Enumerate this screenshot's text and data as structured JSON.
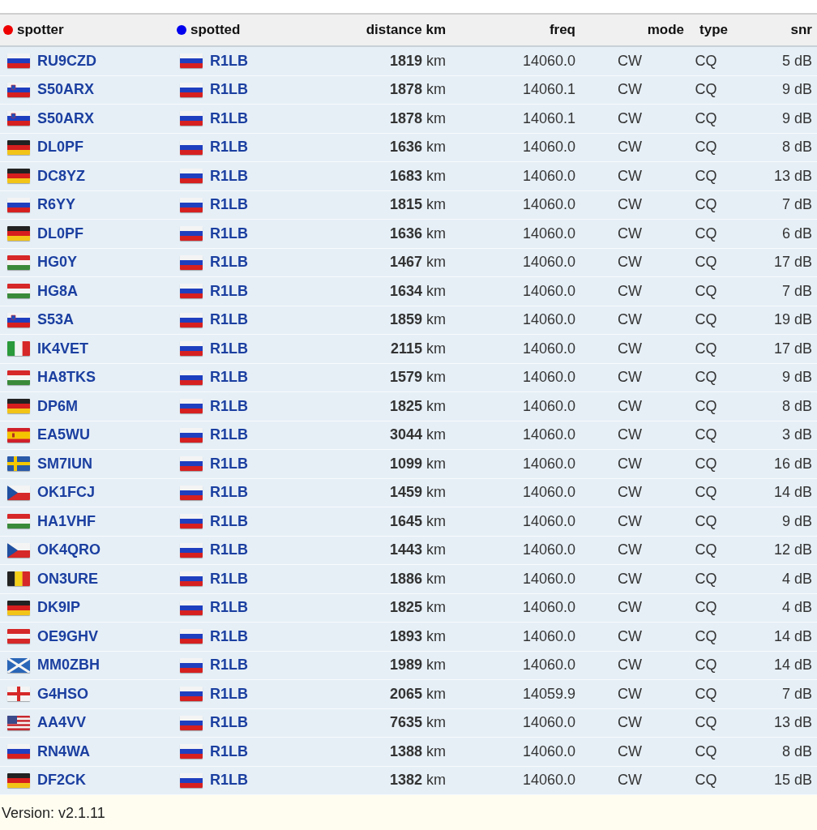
{
  "columns": [
    {
      "label": "spotter",
      "color": "#ee0000"
    },
    {
      "label": "spotted",
      "color": "#0000ee"
    },
    {
      "label": "distance km"
    },
    {
      "label": "freq"
    },
    {
      "label": "mode"
    },
    {
      "label": "type"
    },
    {
      "label": "snr"
    }
  ],
  "rows": [
    {
      "spotter": {
        "kind": "ru",
        "call": "RU9CZD"
      },
      "spotted": {
        "kind": "ru",
        "call": "R1LB"
      },
      "distance": "**1819** km",
      "freq": "14060.0",
      "mode": "CW",
      "type": "CQ",
      "snr": "5 dB"
    },
    {
      "spotter": {
        "kind": "si",
        "call": "S50ARX"
      },
      "spotted": {
        "kind": "ru",
        "call": "R1LB"
      },
      "distance": "**1878** km",
      "freq": "14060.1",
      "mode": "CW",
      "type": "CQ",
      "snr": "9 dB"
    },
    {
      "spotter": {
        "kind": "si",
        "call": "S50ARX"
      },
      "spotted": {
        "kind": "ru",
        "call": "R1LB"
      },
      "distance": "**1878** km",
      "freq": "14060.1",
      "mode": "CW",
      "type": "CQ",
      "snr": "9 dB"
    },
    {
      "spotter": {
        "kind": "de",
        "call": "DL0PF"
      },
      "spotted": {
        "kind": "ru",
        "call": "R1LB"
      },
      "distance": "**1636** km",
      "freq": "14060.0",
      "mode": "CW",
      "type": "CQ",
      "snr": "8 dB"
    },
    {
      "spotter": {
        "kind": "de",
        "call": "DC8YZ"
      },
      "spotted": {
        "kind": "ru",
        "call": "R1LB"
      },
      "distance": "**1683** km",
      "freq": "14060.0",
      "mode": "CW",
      "type": "CQ",
      "snr": "13 dB"
    },
    {
      "spotter": {
        "kind": "ru",
        "call": "R6YY"
      },
      "spotted": {
        "kind": "ru",
        "call": "R1LB"
      },
      "distance": "**1815** km",
      "freq": "14060.0",
      "mode": "CW",
      "type": "CQ",
      "snr": "7 dB"
    },
    {
      "spotter": {
        "kind": "de",
        "call": "DL0PF"
      },
      "spotted": {
        "kind": "ru",
        "call": "R1LB"
      },
      "distance": "**1636** km",
      "freq": "14060.0",
      "mode": "CW",
      "type": "CQ",
      "snr": "6 dB"
    },
    {
      "spotter": {
        "kind": "hu",
        "call": "HG0Y"
      },
      "spotted": {
        "kind": "ru",
        "call": "R1LB"
      },
      "distance": "**1467** km",
      "freq": "14060.0",
      "mode": "CW",
      "type": "CQ",
      "snr": "17 dB"
    },
    {
      "spotter": {
        "kind": "hu",
        "call": "HG8A"
      },
      "spotted": {
        "kind": "ru",
        "call": "R1LB"
      },
      "distance": "**1634** km",
      "freq": "14060.0",
      "mode": "CW",
      "type": "CQ",
      "snr": "7 dB"
    },
    {
      "spotter": {
        "kind": "si",
        "call": "S53A"
      },
      "spotted": {
        "kind": "ru",
        "call": "R1LB"
      },
      "distance": "**1859** km",
      "freq": "14060.0",
      "mode": "CW",
      "type": "CQ",
      "snr": "19 dB"
    },
    {
      "spotter": {
        "kind": "it",
        "call": "IK4VET"
      },
      "spotted": {
        "kind": "ru",
        "call": "R1LB"
      },
      "distance": "**2115** km",
      "freq": "14060.0",
      "mode": "CW",
      "type": "CQ",
      "snr": "17 dB"
    },
    {
      "spotter": {
        "kind": "hu",
        "call": "HA8TKS"
      },
      "spotted": {
        "kind": "ru",
        "call": "R1LB"
      },
      "distance": "**1579** km",
      "freq": "14060.0",
      "mode": "CW",
      "type": "CQ",
      "snr": "9 dB"
    },
    {
      "spotter": {
        "kind": "de",
        "call": "DP6M"
      },
      "spotted": {
        "kind": "ru",
        "call": "R1LB"
      },
      "distance": "**1825** km",
      "freq": "14060.0",
      "mode": "CW",
      "type": "CQ",
      "snr": "8 dB"
    },
    {
      "spotter": {
        "kind": "es",
        "call": "EA5WU"
      },
      "spotted": {
        "kind": "ru",
        "call": "R1LB"
      },
      "distance": "**3044** km",
      "freq": "14060.0",
      "mode": "CW",
      "type": "CQ",
      "snr": "3 dB"
    },
    {
      "spotter": {
        "kind": "se",
        "call": "SM7IUN"
      },
      "spotted": {
        "kind": "ru",
        "call": "R1LB"
      },
      "distance": "**1099** km",
      "freq": "14060.0",
      "mode": "CW",
      "type": "CQ",
      "snr": "16 dB"
    },
    {
      "spotter": {
        "kind": "cz",
        "call": "OK1FCJ"
      },
      "spotted": {
        "kind": "ru",
        "call": "R1LB"
      },
      "distance": "**1459** km",
      "freq": "14060.0",
      "mode": "CW",
      "type": "CQ",
      "snr": "14 dB"
    },
    {
      "spotter": {
        "kind": "hu",
        "call": "HA1VHF"
      },
      "spotted": {
        "kind": "ru",
        "call": "R1LB"
      },
      "distance": "**1645** km",
      "freq": "14060.0",
      "mode": "CW",
      "type": "CQ",
      "snr": "9 dB"
    },
    {
      "spotter": {
        "kind": "cz",
        "call": "OK4QRO"
      },
      "spotted": {
        "kind": "ru",
        "call": "R1LB"
      },
      "distance": "**1443** km",
      "freq": "14060.0",
      "mode": "CW",
      "type": "CQ",
      "snr": "12 dB"
    },
    {
      "spotter": {
        "kind": "be",
        "call": "ON3URE"
      },
      "spotted": {
        "kind": "ru",
        "call": "R1LB"
      },
      "distance": "**1886** km",
      "freq": "14060.0",
      "mode": "CW",
      "type": "CQ",
      "snr": "4 dB"
    },
    {
      "spotter": {
        "kind": "de",
        "call": "DK9IP"
      },
      "spotted": {
        "kind": "ru",
        "call": "R1LB"
      },
      "distance": "**1825** km",
      "freq": "14060.0",
      "mode": "CW",
      "type": "CQ",
      "snr": "4 dB"
    },
    {
      "spotter": {
        "kind": "at",
        "call": "OE9GHV"
      },
      "spotted": {
        "kind": "ru",
        "call": "R1LB"
      },
      "distance": "**1893** km",
      "freq": "14060.0",
      "mode": "CW",
      "type": "CQ",
      "snr": "14 dB"
    },
    {
      "spotter": {
        "kind": "sct",
        "call": "MM0ZBH"
      },
      "spotted": {
        "kind": "ru",
        "call": "R1LB"
      },
      "distance": "**1989** km",
      "freq": "14060.0",
      "mode": "CW",
      "type": "CQ",
      "snr": "14 dB"
    },
    {
      "spotter": {
        "kind": "eng",
        "call": "G4HSO"
      },
      "spotted": {
        "kind": "ru",
        "call": "R1LB"
      },
      "distance": "**2065** km",
      "freq": "14059.9",
      "mode": "CW",
      "type": "CQ",
      "snr": "7 dB"
    },
    {
      "spotter": {
        "kind": "us",
        "call": "AA4VV"
      },
      "spotted": {
        "kind": "ru",
        "call": "R1LB"
      },
      "distance": "**7635** km",
      "freq": "14060.0",
      "mode": "CW",
      "type": "CQ",
      "snr": "13 dB"
    },
    {
      "spotter": {
        "kind": "ru",
        "call": "RN4WA"
      },
      "spotted": {
        "kind": "ru",
        "call": "R1LB"
      },
      "distance": "**1388** km",
      "freq": "14060.0",
      "mode": "CW",
      "type": "CQ",
      "snr": "8 dB"
    },
    {
      "spotter": {
        "kind": "de",
        "call": "DF2CK"
      },
      "spotted": {
        "kind": "ru",
        "call": "R1LB"
      },
      "distance": "**1382** km",
      "freq": "14060.0",
      "mode": "CW",
      "type": "CQ",
      "snr": "15 dB"
    }
  ],
  "footer": "Version: v2.1.11"
}
